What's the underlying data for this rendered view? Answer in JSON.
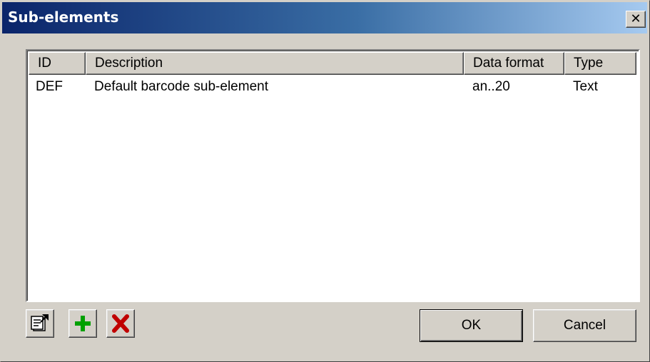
{
  "window": {
    "title": "Sub-elements",
    "close_glyph": "✕"
  },
  "list": {
    "columns": [
      "ID",
      "Description",
      "Data format",
      "Type"
    ],
    "rows": [
      {
        "id": "DEF",
        "description": "Default barcode sub-element",
        "data_format": "an..20",
        "type": "Text"
      }
    ]
  },
  "toolbar": {
    "icons": [
      "properties-icon",
      "add-icon",
      "delete-icon"
    ],
    "add_color": "#00a000",
    "delete_color": "#c00000"
  },
  "buttons": {
    "ok_label": "OK",
    "cancel_label": "Cancel"
  }
}
